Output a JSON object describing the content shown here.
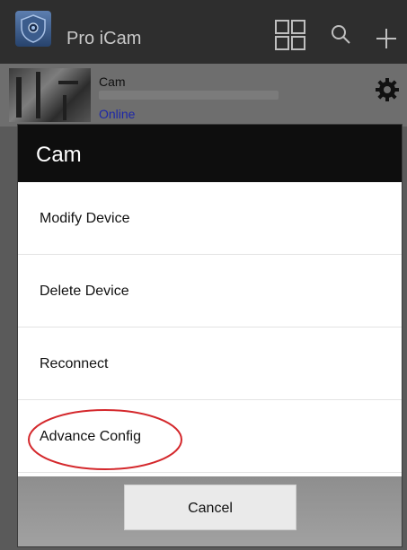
{
  "app": {
    "title": "Pro iCam",
    "icons": [
      "shield-logo",
      "grid-view-icon",
      "search-icon",
      "plus-icon"
    ]
  },
  "device": {
    "name": "Cam",
    "status": "Online",
    "status_color": "#1d27a8"
  },
  "dialog": {
    "title": "Cam",
    "items": [
      {
        "label": "Modify Device"
      },
      {
        "label": "Delete Device"
      },
      {
        "label": "Reconnect"
      },
      {
        "label": "Advance Config",
        "highlighted": true
      }
    ],
    "cancel_label": "Cancel"
  },
  "colors": {
    "appbar": "#2e2e2e",
    "dialog_header": "#0e0e0e",
    "highlight": "#d4282c"
  }
}
